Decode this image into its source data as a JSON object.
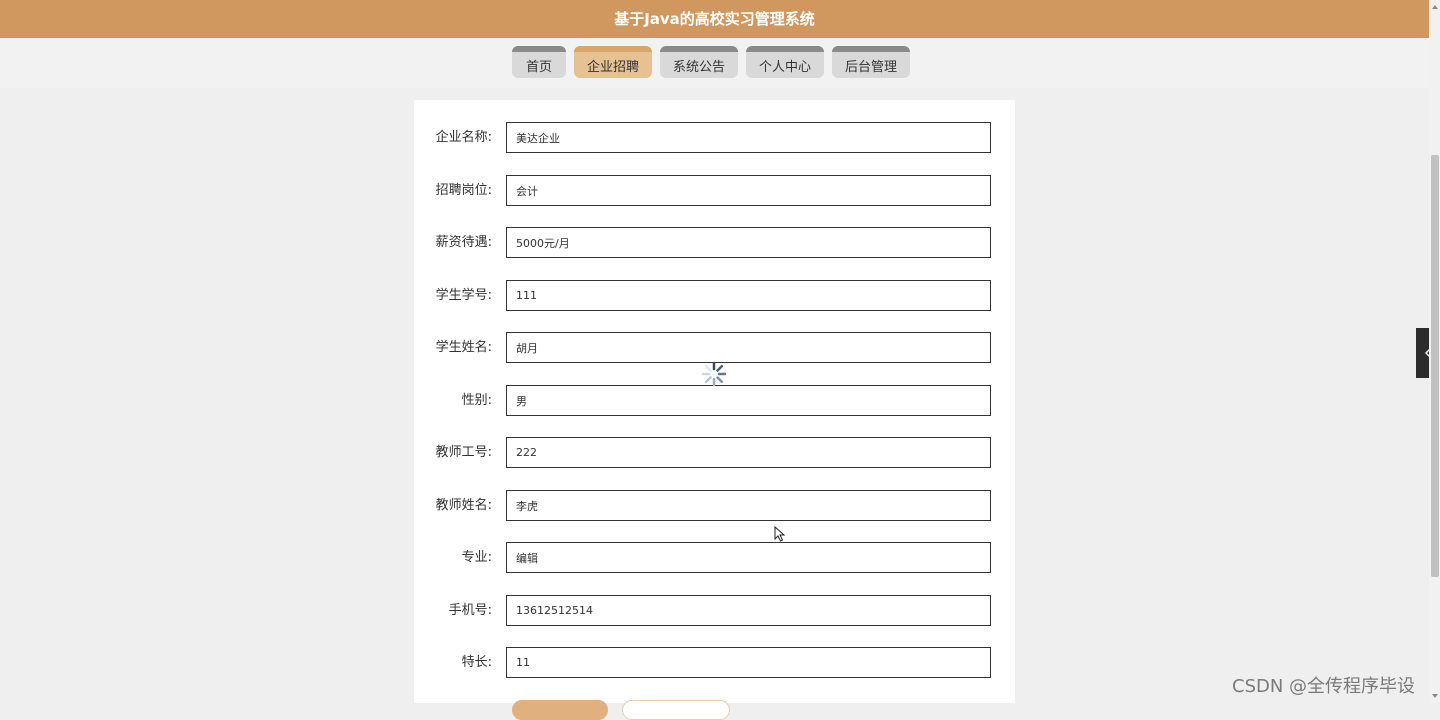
{
  "app": {
    "title": "基于Java的高校实习管理系统"
  },
  "nav": {
    "items": [
      {
        "label": "首页",
        "active": false
      },
      {
        "label": "企业招聘",
        "active": true
      },
      {
        "label": "系统公告",
        "active": false
      },
      {
        "label": "个人中心",
        "active": false
      },
      {
        "label": "后台管理",
        "active": false
      }
    ]
  },
  "form": {
    "fields": [
      {
        "label": "企业名称:",
        "value": "美达企业"
      },
      {
        "label": "招聘岗位:",
        "value": "会计"
      },
      {
        "label": "薪资待遇:",
        "value": "5000元/月"
      },
      {
        "label": "学生学号:",
        "value": "111"
      },
      {
        "label": "学生姓名:",
        "value": "胡月"
      },
      {
        "label": "性别:",
        "value": "男"
      },
      {
        "label": "教师工号:",
        "value": "222"
      },
      {
        "label": "教师姓名:",
        "value": "李虎"
      },
      {
        "label": "专业:",
        "value": "编辑"
      },
      {
        "label": "手机号:",
        "value": "13612512514"
      },
      {
        "label": "特长:",
        "value": "11"
      }
    ]
  },
  "watermark": "CSDN @全传程序毕设",
  "colors": {
    "header": "#d0975e",
    "active_tab": "#e6c293",
    "tab": "#d9d9d9",
    "tab_top": "#8a8a8a"
  },
  "icons": {
    "side_toggle": "chevron-left-icon",
    "loading": "loading-spinner-icon"
  }
}
